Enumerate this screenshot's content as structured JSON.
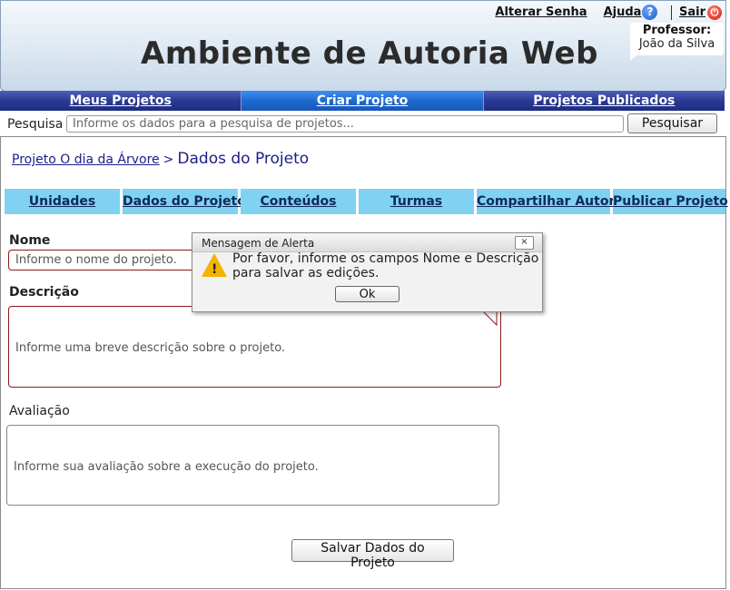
{
  "header": {
    "title": "Ambiente de Autoria Web",
    "links": {
      "change_password": "Alterar Senha",
      "help": "Ajuda",
      "logout": "Sair"
    },
    "user": {
      "role": "Professor:",
      "name": "João da Silva"
    }
  },
  "nav": {
    "items": [
      "Meus Projetos",
      "Criar Projeto",
      "Projetos Publicados"
    ],
    "active": "Criar Projeto"
  },
  "search": {
    "label": "Pesquisa",
    "placeholder": "Informe os dados para a pesquisa de projetos...",
    "button": "Pesquisar"
  },
  "breadcrumb": {
    "project": "Projeto O dia da Árvore",
    "separator": ">",
    "current": "Dados do Projeto"
  },
  "tabs": [
    "Unidades",
    "Dados do Projeto",
    "Conteúdos",
    "Turmas",
    "Compartilhar Autoria",
    "Publicar Projeto"
  ],
  "form": {
    "name_label": "Nome",
    "name_placeholder": "Informe o nome do projeto.",
    "description_label": "Descrição",
    "description_placeholder": "Informe uma breve descrição sobre o projeto.",
    "evaluation_label": "Avaliação",
    "evaluation_placeholder": "Informe sua avaliação sobre a execução do projeto.",
    "save_button": "Salvar Dados do Projeto"
  },
  "alert": {
    "title": "Mensagem de Alerta",
    "close": "×",
    "message": "Por favor, informe os campos Nome e Descrição para salvar as edições.",
    "ok": "Ok"
  },
  "colors": {
    "nav": "#2a3a94",
    "nav_active": "#1e6ad0",
    "tab": "#7fd2f2",
    "required_border": "#8b1a1a",
    "warning": "#f1b400"
  }
}
